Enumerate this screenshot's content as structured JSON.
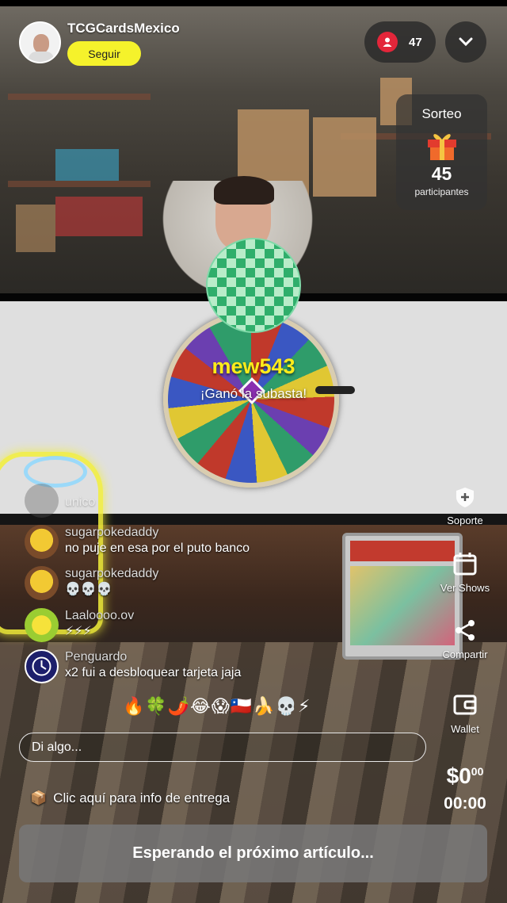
{
  "host": {
    "name": "TCGCardsMexico",
    "follow_label": "Seguir"
  },
  "viewers": {
    "count": "47",
    "icon": "person-icon"
  },
  "raffle": {
    "title": "Sorteo",
    "count": "45",
    "label": "participantes",
    "icon": "gift-icon"
  },
  "winner": {
    "name": "mew543",
    "message": "¡Ganó la subasta!"
  },
  "actions": [
    {
      "label": "Soporte",
      "icon": "shield-icon"
    },
    {
      "label": "Ver Shows",
      "icon": "calendar-icon"
    },
    {
      "label": "Compartir",
      "icon": "share-icon"
    },
    {
      "label": "Wallet",
      "icon": "wallet-icon"
    }
  ],
  "price": {
    "amount": "$0",
    "cents": "00",
    "timer": "00:00"
  },
  "chat": [
    {
      "user": "",
      "message": "unico"
    },
    {
      "user": "sugarpokedaddy",
      "message": "no puje en esa por el puto banco"
    },
    {
      "user": "sugarpokedaddy",
      "message": "💀💀💀"
    },
    {
      "user": "Laaloooo.ov",
      "message": "⚡⚡⚡"
    },
    {
      "user": "Penguardo",
      "message": "x2 fui a desbloquear tarjeta jaja"
    }
  ],
  "emoji_bar": "🔥🍀🌶️😂😱🇨🇱🍌💀⚡",
  "input": {
    "placeholder": "Di algo..."
  },
  "delivery": {
    "text": "Clic aquí para info de entrega",
    "icon": "package-icon"
  },
  "waiting_label": "Esperando el próximo artículo...",
  "colors": {
    "accent_yellow": "#f5f22b",
    "viewer_red": "#e3263a",
    "winner_yellow": "#ffec1a"
  }
}
